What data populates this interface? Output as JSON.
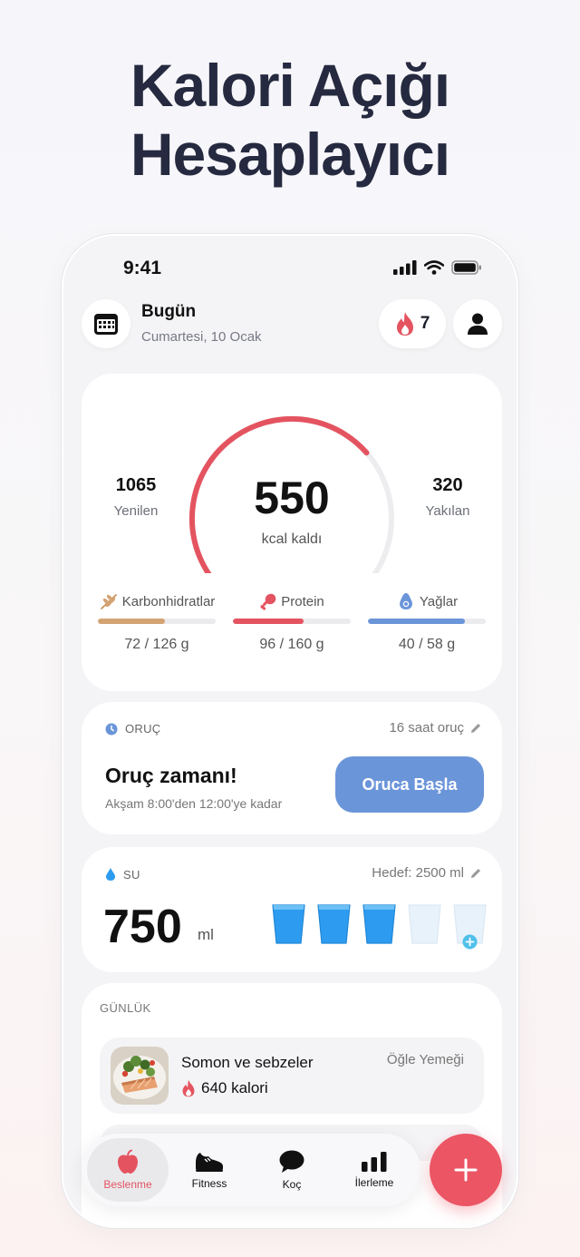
{
  "headline": {
    "line1": "Kalori Açığı",
    "line2": "Hesaplayıcı"
  },
  "status_bar": {
    "time": "9:41"
  },
  "header": {
    "title": "Bugün",
    "date": "Cumartesi, 10 Ocak",
    "streak_count": "7"
  },
  "calories": {
    "eaten_value": "1065",
    "eaten_label": "Yenilen",
    "remaining_value": "550",
    "remaining_label": "kcal kaldı",
    "burned_value": "320",
    "burned_label": "Yakılan",
    "progress_fraction": 0.68,
    "ring_color": "#e45460"
  },
  "macros": [
    {
      "name": "Karbonhidratlar",
      "value": "72 / 126 g",
      "fraction": 0.57,
      "color": "#d4a373"
    },
    {
      "name": "Protein",
      "value": "96 / 160 g",
      "fraction": 0.6,
      "color": "#e45460"
    },
    {
      "name": "Yağlar",
      "value": "40 / 58 g",
      "fraction": 0.82,
      "color": "#6b95d9"
    }
  ],
  "fasting": {
    "label": "ORUÇ",
    "plan": "16 saat oruç",
    "headline": "Oruç zamanı!",
    "subtitle": "Akşam 8:00'den 12:00'ye kadar",
    "button_label": "Oruca Başla"
  },
  "water": {
    "label": "SU",
    "goal": "Hedef: 2500 ml",
    "amount": "750",
    "unit": "ml",
    "cups_filled": 3,
    "cups_total": 5
  },
  "log": {
    "label": "GÜNLÜK",
    "entries": [
      {
        "name": "Somon ve sebzeler",
        "calories": "640 kalori",
        "meal": "Öğle Yemeği"
      }
    ]
  },
  "nav": {
    "items": [
      {
        "label": "Beslenme",
        "icon": "apple-icon",
        "active": true
      },
      {
        "label": "Fitness",
        "icon": "shoe-icon"
      },
      {
        "label": "Koç",
        "icon": "chat-icon"
      },
      {
        "label": "İlerleme",
        "icon": "bar-chart-icon"
      }
    ]
  },
  "colors": {
    "accent": "#e45460",
    "primary_blue": "#6b95d9",
    "water_blue": "#2d9cf0"
  }
}
